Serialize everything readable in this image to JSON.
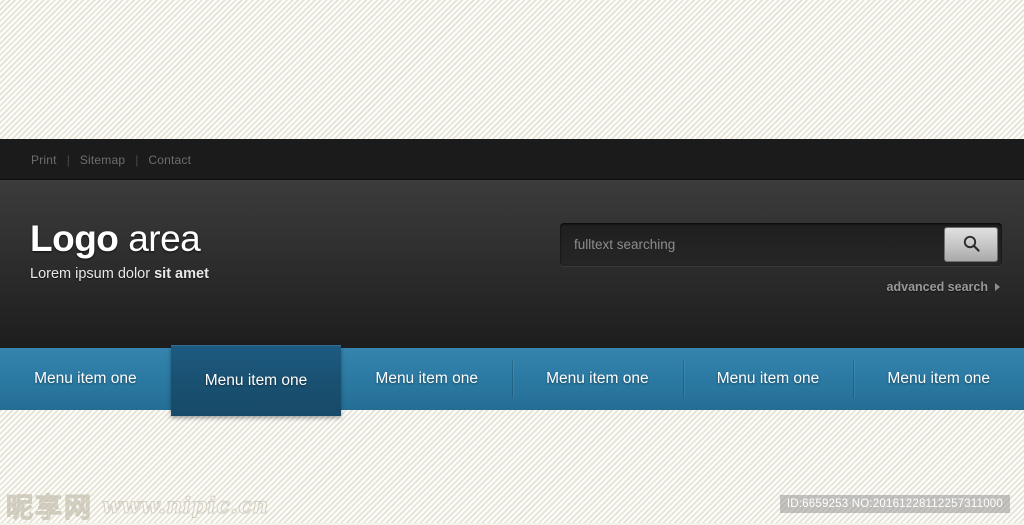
{
  "utility_bar": {
    "links": [
      {
        "label": "Print"
      },
      {
        "label": "Sitemap"
      },
      {
        "label": "Contact"
      }
    ],
    "separator": "|"
  },
  "header": {
    "logo": {
      "title_strong": "Logo",
      "title_light": "area",
      "tagline_normal": "Lorem ipsum dolor",
      "tagline_bold": "sit amet"
    },
    "search": {
      "placeholder": "fulltext searching",
      "value": "",
      "button_icon": "search-icon",
      "advanced_label": "advanced search",
      "advanced_arrow": "triangle-right-icon"
    }
  },
  "menu": {
    "items": [
      {
        "label": "Menu item one",
        "active": false
      },
      {
        "label": "Menu item one",
        "active": true
      },
      {
        "label": "Menu item one",
        "active": false
      },
      {
        "label": "Menu item one",
        "active": false
      },
      {
        "label": "Menu item one",
        "active": false
      },
      {
        "label": "Menu item one",
        "active": false
      }
    ]
  },
  "watermarks": {
    "brand_cjk": "昵享网",
    "brand_url": "www.nipic.cn",
    "id_text": "ID:6659253 NO:20161228112257311000"
  },
  "colors": {
    "page_background": "#f5f3ea",
    "utility_bar": "#1b1b1b",
    "header_top": "#3b3b3b",
    "header_bottom": "#1d1d1d",
    "menu_blue_top": "#3684ad",
    "menu_blue_bottom": "#246e95",
    "menu_active": "#195070",
    "search_button_light": "#e0e0e0",
    "search_button_dark": "#a9a9a9"
  }
}
